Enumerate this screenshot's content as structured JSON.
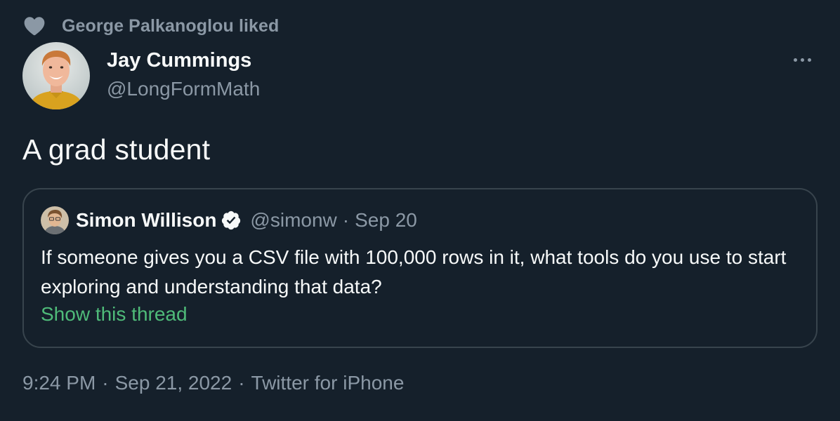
{
  "social_context": {
    "text": "George Palkanoglou liked",
    "icon": "heart-icon"
  },
  "author": {
    "name": "Jay Cummings",
    "handle": "@LongFormMath",
    "avatar": "avatar-photo"
  },
  "more_icon": "more-dots-icon",
  "tweet": {
    "text": "A grad student"
  },
  "quote": {
    "name": "Simon Willison",
    "verified_icon": "verified-badge-icon",
    "handle": "@simonw",
    "separator": "·",
    "date": "Sep 20",
    "body": "If someone gives you a CSV file with 100,000 rows in it, what tools do you use to start exploring and understanding that data?",
    "show_thread": "Show this thread"
  },
  "meta": {
    "time": "9:24 PM",
    "separator": "·",
    "date": "Sep 21, 2022",
    "source": "Twitter for iPhone"
  },
  "colors": {
    "background": "#15202b",
    "primary_text": "#f7f9f9",
    "secondary_text": "#8b98a5",
    "border": "#38444d",
    "link_green": "#4fbb79"
  }
}
